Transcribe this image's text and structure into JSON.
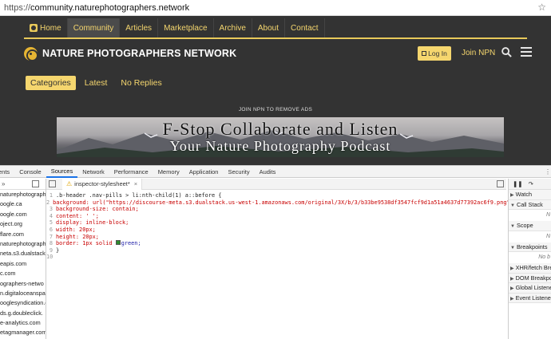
{
  "browser": {
    "url_prefix": "https://",
    "url_host": "community.naturephotographers.network"
  },
  "nav": {
    "items": [
      {
        "label": "Home",
        "active": false
      },
      {
        "label": "Community",
        "active": true
      },
      {
        "label": "Articles",
        "active": false
      },
      {
        "label": "Marketplace",
        "active": false
      },
      {
        "label": "Archive",
        "active": false
      },
      {
        "label": "About",
        "active": false
      },
      {
        "label": "Contact",
        "active": false
      }
    ]
  },
  "header": {
    "title": "NATURE PHOTOGRAPHERS NETWORK",
    "login_label": "Log In",
    "join_label": "Join NPN"
  },
  "subnav": {
    "pills": [
      "Categories",
      "Latest",
      "No Replies"
    ]
  },
  "ad": {
    "label": "JOIN NPN TO REMOVE ADS",
    "line1": "F-Stop Collaborate and Listen",
    "line2": "Your Nature Photography Podcast"
  },
  "devtools": {
    "tabs": [
      "ents",
      "Console",
      "Sources",
      "Network",
      "Performance",
      "Memory",
      "Application",
      "Security",
      "Audits"
    ],
    "active_tab": "Sources",
    "left_header": "»",
    "sources": [
      "naturephotograph",
      "oogle.ca",
      "oogle.com",
      "oject.org",
      "flare.com",
      "naturephotograph",
      "neta.s3.dualstack",
      "eapis.com",
      "c.com",
      "ographers-netwo",
      "n.digitaloceanspa",
      "ooglesyndication.c",
      "ds.g.doubleclick.",
      "e-analytics.com",
      "etagmanager.com"
    ],
    "file_tab": "inspector-stylesheet*",
    "code_lines": [
      ".b-header .nav-pills > li:nth-child(1) a::before {",
      "background: url(\"https://discourse-meta.s3.dualstack.us-west-1.amazonaws.com/original/3X/b/3/b33be9538df3547fcf9d1a51a4637d77392ac6f9.png\");",
      "background-size: contain;",
      "content: ' ';",
      "display: inline-block;",
      "width: 20px;",
      "height: 20px;",
      "border: 1px solid ",
      "}",
      ""
    ],
    "border_color_word": "green;",
    "right_sections": [
      {
        "label": "Watch",
        "body": ""
      },
      {
        "label": "Call Stack",
        "body": "N"
      },
      {
        "label": "Scope",
        "body": "N"
      },
      {
        "label": "Breakpoints",
        "body": "No b"
      },
      {
        "label": "XHR/fetch Brea",
        "body": ""
      },
      {
        "label": "DOM Breakpoi",
        "body": ""
      },
      {
        "label": "Global Listener",
        "body": ""
      },
      {
        "label": "Event Listener",
        "body": ""
      }
    ]
  }
}
